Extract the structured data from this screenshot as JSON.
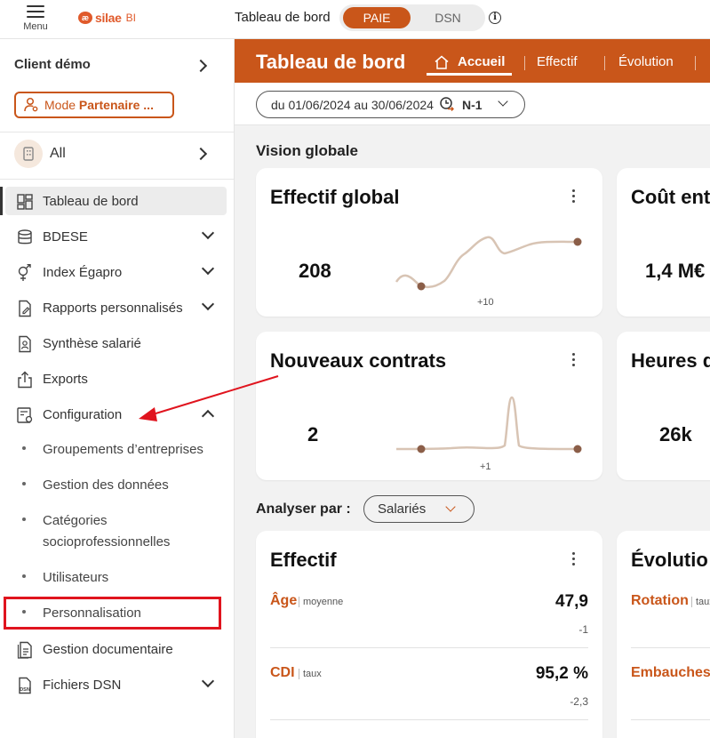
{
  "topbar": {
    "menu_label": "Menu",
    "logo_text": "silae",
    "logo_suffix": "BI",
    "title": "Tableau de bord",
    "toggle": {
      "paie": "PAIE",
      "dsn": "DSN",
      "selected": "PAIE"
    },
    "info_glyph": "i"
  },
  "sidebar": {
    "client": "Client démo",
    "mode_button": {
      "prefix": "Mode ",
      "bold": "Partenaire ..."
    },
    "scope": "All",
    "items": [
      {
        "label": "Tableau de bord",
        "icon": "dashboard-icon",
        "active": true
      },
      {
        "label": "BDESE",
        "icon": "database-icon",
        "expandable": true
      },
      {
        "label": "Index Égapro",
        "icon": "gender-icon",
        "expandable": true
      },
      {
        "label": "Rapports personnalisés",
        "icon": "report-edit-icon",
        "expandable": true
      },
      {
        "label": "Synthèse salarié",
        "icon": "employee-summary-icon"
      },
      {
        "label": "Exports",
        "icon": "export-icon"
      },
      {
        "label": "Configuration",
        "icon": "configuration-icon",
        "expanded": true
      },
      {
        "label": "Gestion documentaire",
        "icon": "document-icon"
      },
      {
        "label": "Fichiers DSN",
        "icon": "dsn-file-icon",
        "expandable": true
      }
    ],
    "config_sub": [
      "Groupements d’entreprises",
      "Gestion des données",
      "Catégories socioprofessionnelles",
      "Utilisateurs",
      "Personnalisation"
    ],
    "config_sub_wrapped": [
      "Catégories",
      "socioprofessionnelles"
    ]
  },
  "main": {
    "title": "Tableau de bord",
    "tabs": [
      "Accueil",
      "Effectif",
      "Évolution"
    ],
    "active_tab": "Accueil",
    "date_range": "du 01/06/2024 au 30/06/2024",
    "comparison": "N-1",
    "vision_title": "Vision globale",
    "cards": [
      {
        "title": "Effectif global",
        "value": "208",
        "delta": "+10"
      },
      {
        "title": "Coût ent",
        "value": "1,4 M€"
      },
      {
        "title": "Nouveaux contrats",
        "value": "2",
        "delta": "+1"
      },
      {
        "title": "Heures d",
        "value": "26k"
      }
    ],
    "analyse_label": "Analyser par :",
    "analyse_select": "Salariés",
    "effectif_card": {
      "title": "Effectif",
      "rows": [
        {
          "label": "Âge",
          "sub": "moyenne",
          "value": "47,9",
          "delta": "-1"
        },
        {
          "label": "CDI",
          "sub": "taux",
          "value": "95,2 %",
          "delta": "-2,3"
        }
      ]
    },
    "evolution_card": {
      "title": "Évolutio",
      "rows": [
        {
          "label": "Rotation",
          "sub": "taux"
        },
        {
          "label": "Embauches",
          "sub": ""
        }
      ]
    }
  },
  "colors": {
    "accent": "#c9561a",
    "annotation": "#e0141e",
    "sparkline": "#d8c4b4",
    "sparkline_point": "#8b5e48"
  }
}
